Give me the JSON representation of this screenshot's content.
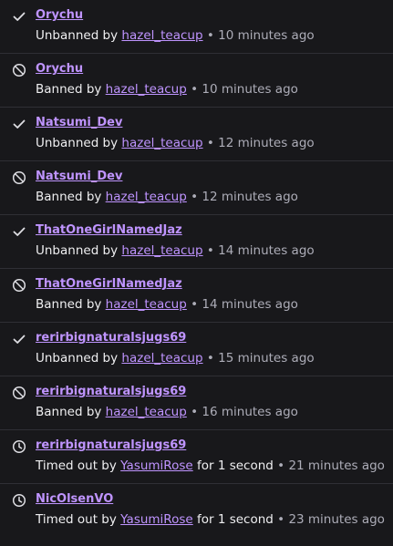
{
  "entries": [
    {
      "icon": "check-icon",
      "username": "Orychu",
      "action": "Unbanned by",
      "moderator": "hazel_teacup",
      "duration": "",
      "time": "10 minutes ago"
    },
    {
      "icon": "ban-icon",
      "username": "Orychu",
      "action": "Banned by",
      "moderator": "hazel_teacup",
      "duration": "",
      "time": "10 minutes ago"
    },
    {
      "icon": "check-icon",
      "username": "Natsumi_Dev",
      "action": "Unbanned by",
      "moderator": "hazel_teacup",
      "duration": "",
      "time": "12 minutes ago"
    },
    {
      "icon": "ban-icon",
      "username": "Natsumi_Dev",
      "action": "Banned by",
      "moderator": "hazel_teacup",
      "duration": "",
      "time": "12 minutes ago"
    },
    {
      "icon": "check-icon",
      "username": "ThatOneGirlNamedJaz",
      "action": "Unbanned by",
      "moderator": "hazel_teacup",
      "duration": "",
      "time": "14 minutes ago"
    },
    {
      "icon": "ban-icon",
      "username": "ThatOneGirlNamedJaz",
      "action": "Banned by",
      "moderator": "hazel_teacup",
      "duration": "",
      "time": "14 minutes ago"
    },
    {
      "icon": "check-icon",
      "username": "rerirbignaturalsjugs69",
      "action": "Unbanned by",
      "moderator": "hazel_teacup",
      "duration": "",
      "time": "15 minutes ago"
    },
    {
      "icon": "ban-icon",
      "username": "rerirbignaturalsjugs69",
      "action": "Banned by",
      "moderator": "hazel_teacup",
      "duration": "",
      "time": "16 minutes ago"
    },
    {
      "icon": "clock-icon",
      "username": "rerirbignaturalsjugs69",
      "action": "Timed out by",
      "moderator": "YasumiRose",
      "duration": "for 1 second",
      "time": "21 minutes ago"
    },
    {
      "icon": "clock-icon",
      "username": "NicOlsenVO",
      "action": "Timed out by",
      "moderator": "YasumiRose",
      "duration": "for 1 second",
      "time": "23 minutes ago"
    }
  ],
  "separator": "•",
  "colors": {
    "background": "#18181b",
    "link": "#bf94ff",
    "text": "#efeff1",
    "muted": "#adadb8",
    "divider": "#2f2f35"
  }
}
